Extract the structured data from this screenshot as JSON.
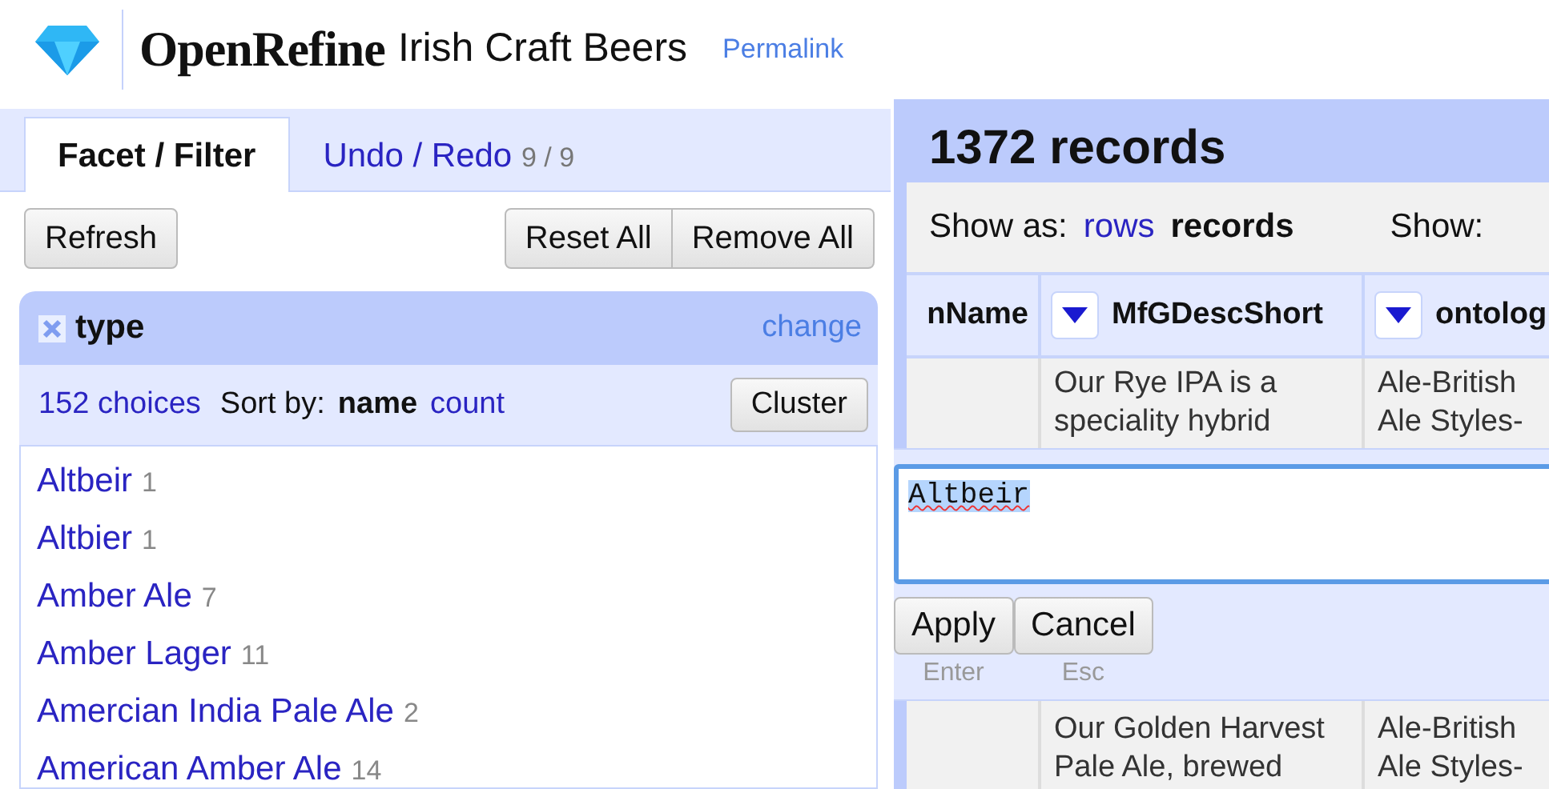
{
  "header": {
    "logo_text": "OpenRefine",
    "project_title": "Irish Craft Beers",
    "permalink": "Permalink"
  },
  "left_panel": {
    "tabs": [
      {
        "label": "Facet / Filter",
        "selected": true
      },
      {
        "label": "Undo / Redo",
        "count": "9 / 9",
        "selected": false
      }
    ],
    "buttons": {
      "refresh": "Refresh",
      "reset_all": "Reset All",
      "remove_all": "Remove All"
    },
    "facet": {
      "title": "type",
      "change": "change",
      "choices": "152 choices",
      "sort_label": "Sort by:",
      "sort_options": [
        {
          "label": "name",
          "selected": true
        },
        {
          "label": "count",
          "selected": false
        }
      ],
      "cluster": "Cluster",
      "items": [
        {
          "name": "Altbeir",
          "count": "1"
        },
        {
          "name": "Altbier",
          "count": "1"
        },
        {
          "name": "Amber Ale",
          "count": "7"
        },
        {
          "name": "Amber Lager",
          "count": "11"
        },
        {
          "name": "Amercian India Pale Ale",
          "count": "2"
        },
        {
          "name": "American Amber Ale",
          "count": "14"
        }
      ]
    }
  },
  "data_panel": {
    "summary": "1372 records",
    "show_as_label": "Show as:",
    "view_modes": [
      {
        "label": "rows",
        "selected": false
      },
      {
        "label": "records",
        "selected": true
      }
    ],
    "show_label": "Show:",
    "columns": [
      {
        "name": "nName",
        "has_menu": false
      },
      {
        "name": "MfGDescShort",
        "has_menu": true
      },
      {
        "name": "ontolog",
        "has_menu": true
      }
    ],
    "rows": [
      {
        "mfgdescshort": [
          "Our Rye IPA is a",
          "speciality hybrid"
        ],
        "ontolog": [
          "Ale-British",
          "Ale Styles-"
        ]
      },
      {
        "mfgdescshort": [
          "Our Golden Harvest",
          "Pale Ale, brewed"
        ],
        "ontolog": [
          "Ale-British",
          "Ale Styles-"
        ]
      }
    ]
  },
  "cell_editor": {
    "value": "Altbeir",
    "buttons": [
      {
        "label": "Apply",
        "shortcut": "Enter"
      },
      {
        "label": "Cancel",
        "shortcut": "Esc"
      }
    ]
  }
}
